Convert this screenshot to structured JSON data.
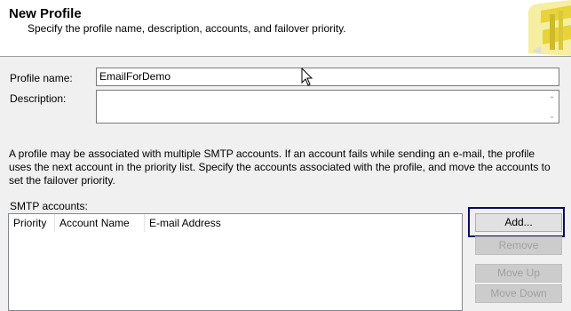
{
  "header": {
    "title": "New Profile",
    "subtitle": "Specify the profile name, description, accounts, and failover priority."
  },
  "form": {
    "profile_name_label": "Profile name:",
    "profile_name_value": "EmailForDemo",
    "description_label": "Description:",
    "description_value": ""
  },
  "info_text": "A profile may be associated with multiple SMTP accounts. If an account fails while sending an e-mail, the profile uses the next account in the priority list. Specify the accounts associated with the profile, and move the accounts to set the failover priority.",
  "smtp": {
    "label": "SMTP accounts:",
    "columns": [
      "Priority",
      "Account Name",
      "E-mail Address"
    ],
    "rows": []
  },
  "buttons": {
    "add": "Add...",
    "remove": "Remove",
    "move_up": "Move Up",
    "move_down": "Move Down"
  },
  "colors": {
    "background": "#f0f0f0",
    "focus_ring": "#0a0a5c",
    "logo_yellow": "#f2e36a"
  }
}
